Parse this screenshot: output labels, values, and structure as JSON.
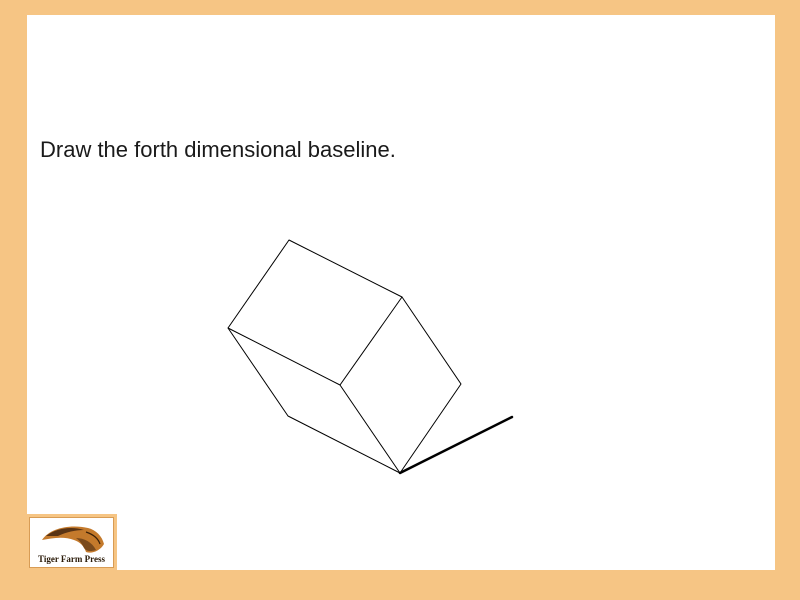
{
  "instruction": "Draw the forth dimensional baseline.",
  "logo": {
    "text": "Tiger Farm Press",
    "icon": "tiger-farm-press-logo-icon"
  },
  "colors": {
    "frame": "#f6c584",
    "panel": "#ffffff",
    "line": "#000000"
  }
}
